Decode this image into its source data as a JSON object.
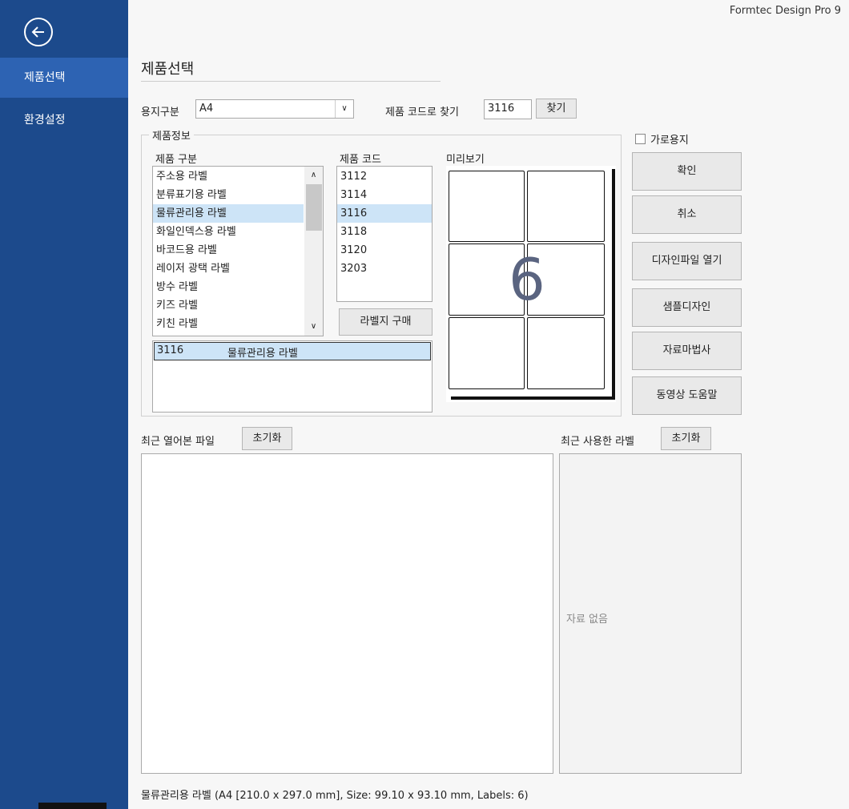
{
  "app_title": "Formtec Design Pro 9",
  "sidebar": {
    "items": [
      {
        "label": "제품선택",
        "selected": true
      },
      {
        "label": "환경설정",
        "selected": false
      }
    ]
  },
  "page_title": "제품선택",
  "paper": {
    "label": "용지구분",
    "value": "A4"
  },
  "find": {
    "label": "제품 코드로 찾기",
    "value": "3116",
    "button": "찾기"
  },
  "landscape": {
    "label": "가로용지",
    "checked": false
  },
  "info_group": {
    "title": "제품정보",
    "category_header": "제품 구분",
    "code_header": "제품 코드",
    "preview_header": "미리보기",
    "categories": [
      "주소용 라벨",
      "분류표기용 라벨",
      "물류관리용 라벨",
      "화일인덱스용 라벨",
      "바코드용 라벨",
      "레이저 광택 라벨",
      "방수 라벨",
      "키즈 라벨",
      "키친 라벨"
    ],
    "selected_category": "물류관리용 라벨",
    "codes": [
      "3112",
      "3114",
      "3116",
      "3118",
      "3120",
      "3203"
    ],
    "selected_code": "3116",
    "buy_button": "라벨지 구매",
    "result_code": "3116",
    "result_name": "물류관리용 라벨",
    "preview_count": "6"
  },
  "actions": [
    "확인",
    "취소",
    "디자인파일 열기",
    "샘플디자인",
    "자료마법사",
    "동영상 도움말"
  ],
  "recent_files": {
    "label": "최근 열어본 파일",
    "reset": "초기화"
  },
  "recent_labels": {
    "label": "최근 사용한 라벨",
    "reset": "초기화",
    "empty": "자료 없음"
  },
  "status": "물류관리용 라벨 (A4 [210.0 x 297.0 mm], Size: 99.10 x 93.10 mm, Labels: 6)",
  "colors": {
    "sidebar": "#1c4a8c",
    "sidebar_selected": "#2d63b3",
    "selection": "#cde4f7"
  }
}
